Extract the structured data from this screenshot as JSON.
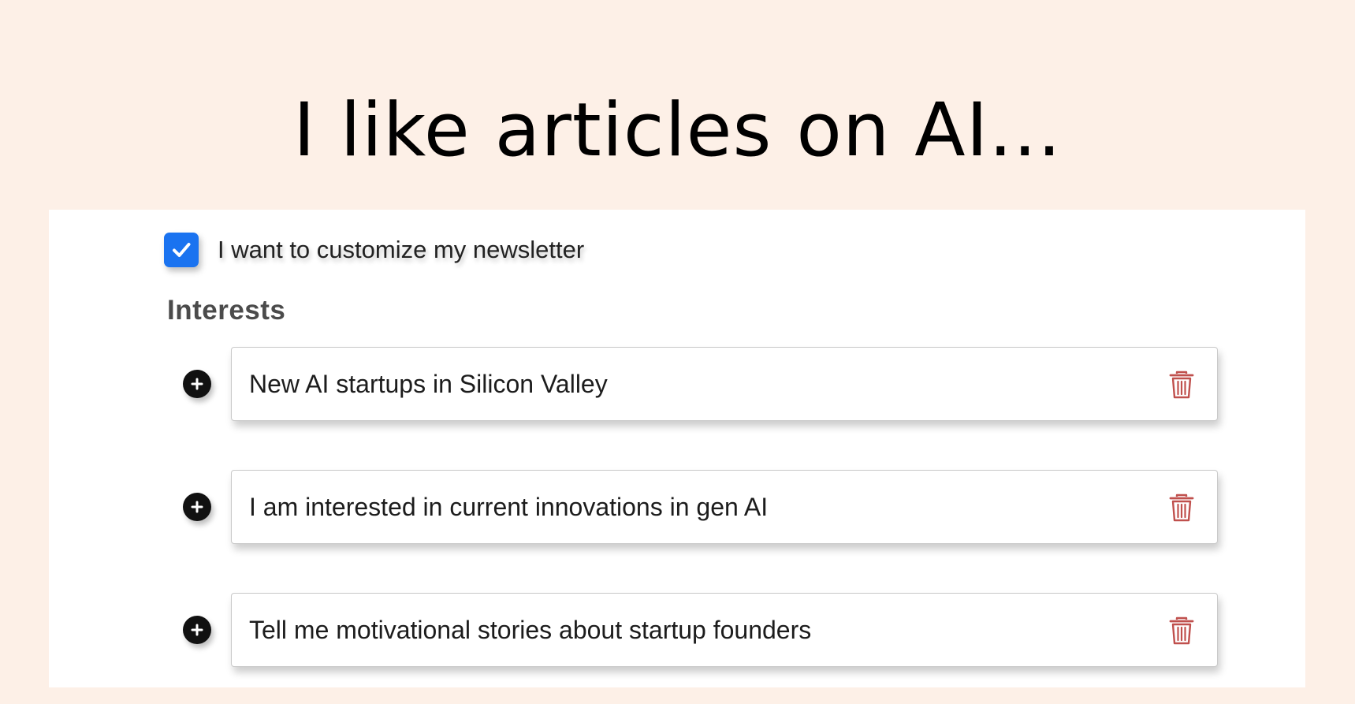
{
  "headline": "I like articles on AI...",
  "form": {
    "customize_checkbox": {
      "label": "I want to customize my newsletter",
      "checked": true,
      "color": "#1a73f0"
    },
    "interests_label": "Interests",
    "interests": [
      {
        "value": "New AI startups in Silicon Valley",
        "add_icon": "plus-circle-icon",
        "delete_icon": "trash-icon"
      },
      {
        "value": "I am interested in current innovations in gen AI",
        "add_icon": "plus-circle-icon",
        "delete_icon": "trash-icon"
      },
      {
        "value": "Tell me motivational stories about startup founders",
        "add_icon": "plus-circle-icon",
        "delete_icon": "trash-icon"
      }
    ]
  },
  "colors": {
    "background": "#fdf0e7",
    "panel": "#ffffff",
    "checkbox": "#1a73f0",
    "trash_icon": "#c0504d"
  }
}
